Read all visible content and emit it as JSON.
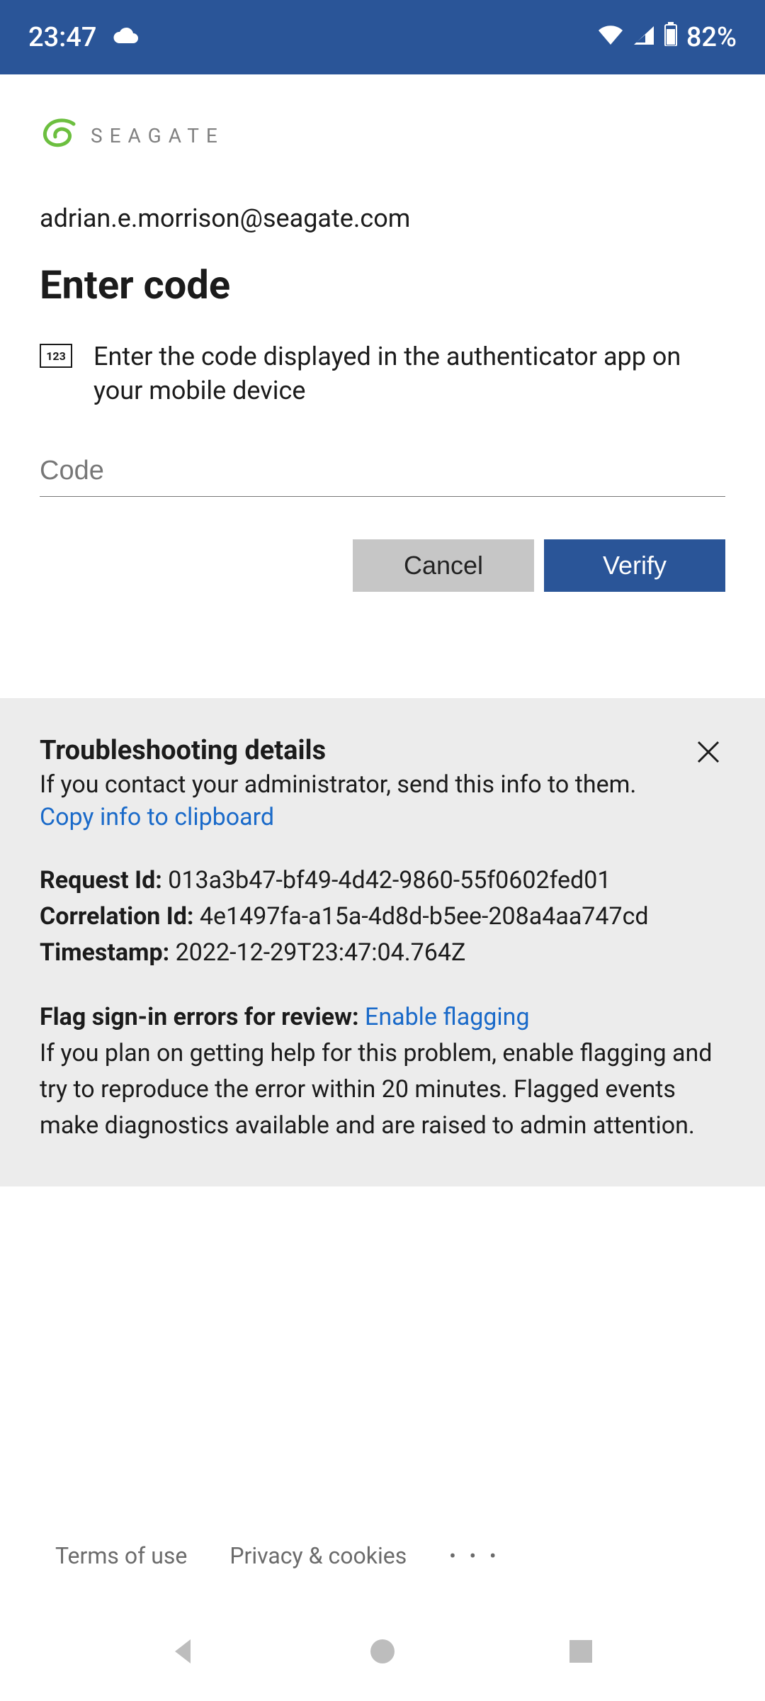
{
  "status": {
    "time": "23:47",
    "battery": "82%"
  },
  "logo": {
    "brand": "SEAGATE"
  },
  "account": {
    "email": "adrian.e.morrison@seagate.com"
  },
  "page": {
    "title": "Enter code",
    "instruction": "Enter the code displayed in the authenticator app on your mobile device"
  },
  "input": {
    "placeholder": "Code"
  },
  "buttons": {
    "cancel": "Cancel",
    "verify": "Verify"
  },
  "troubleshoot": {
    "title": "Troubleshooting details",
    "subtitle": "If you contact your administrator, send this info to them.",
    "copy_link": "Copy info to clipboard",
    "request_id_label": "Request Id:",
    "request_id": "013a3b47-bf49-4d42-9860-55f0602fed01",
    "correlation_id_label": "Correlation Id:",
    "correlation_id": "4e1497fa-a15a-4d8d-b5ee-208a4aa747cd",
    "timestamp_label": "Timestamp:",
    "timestamp": "2022-12-29T23:47:04.764Z",
    "flag_label": "Flag sign-in errors for review:",
    "flag_link": "Enable flagging",
    "flag_desc": "If you plan on getting help for this problem, enable flagging and try to reproduce the error within 20 minutes. Flagged events make diagnostics available and are raised to admin attention."
  },
  "footer": {
    "terms": "Terms of use",
    "privacy": "Privacy & cookies"
  }
}
